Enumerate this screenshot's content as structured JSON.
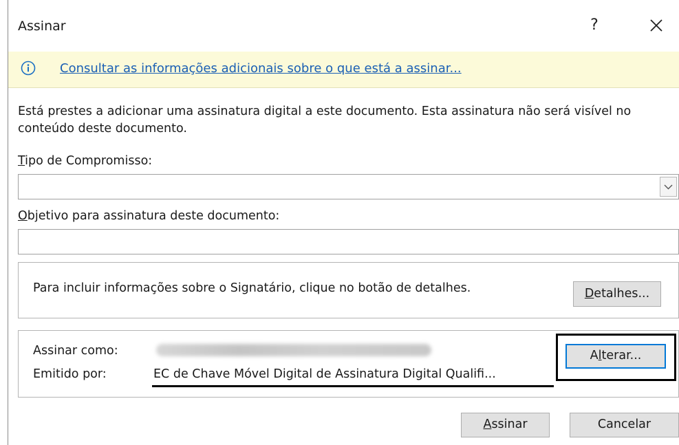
{
  "window": {
    "title": "Assinar",
    "help_label": "?",
    "close_icon": "close-icon"
  },
  "infobar": {
    "icon": "info-icon",
    "link_text": "Consultar as informações adicionais sobre o que está a assinar..."
  },
  "intro_text": "Está prestes a adicionar uma assinatura digital a este documento. Esta assinatura não será visível no conteúdo deste documento.",
  "commitment": {
    "label_accel": "T",
    "label_rest": "ipo de Compromisso:",
    "value": ""
  },
  "purpose": {
    "label_accel": "O",
    "label_rest": "bjetivo para assinatura deste documento:",
    "value": ""
  },
  "signer_info": {
    "text": "Para incluir informações sobre o Signatário, clique no botão de detalhes.",
    "details_accel": "D",
    "details_rest": "etalhes..."
  },
  "signing_as": {
    "sign_as_label": "Assinar como:",
    "issued_by_label": "Emitido por:",
    "issued_by_value": "EC de Chave Móvel Digital de Assinatura Digital Qualifi...",
    "change_pre": "A",
    "change_accel": "l",
    "change_rest": "terar..."
  },
  "footer": {
    "sign_accel": "A",
    "sign_rest": "ssinar",
    "cancel_label": "Cancelar"
  }
}
